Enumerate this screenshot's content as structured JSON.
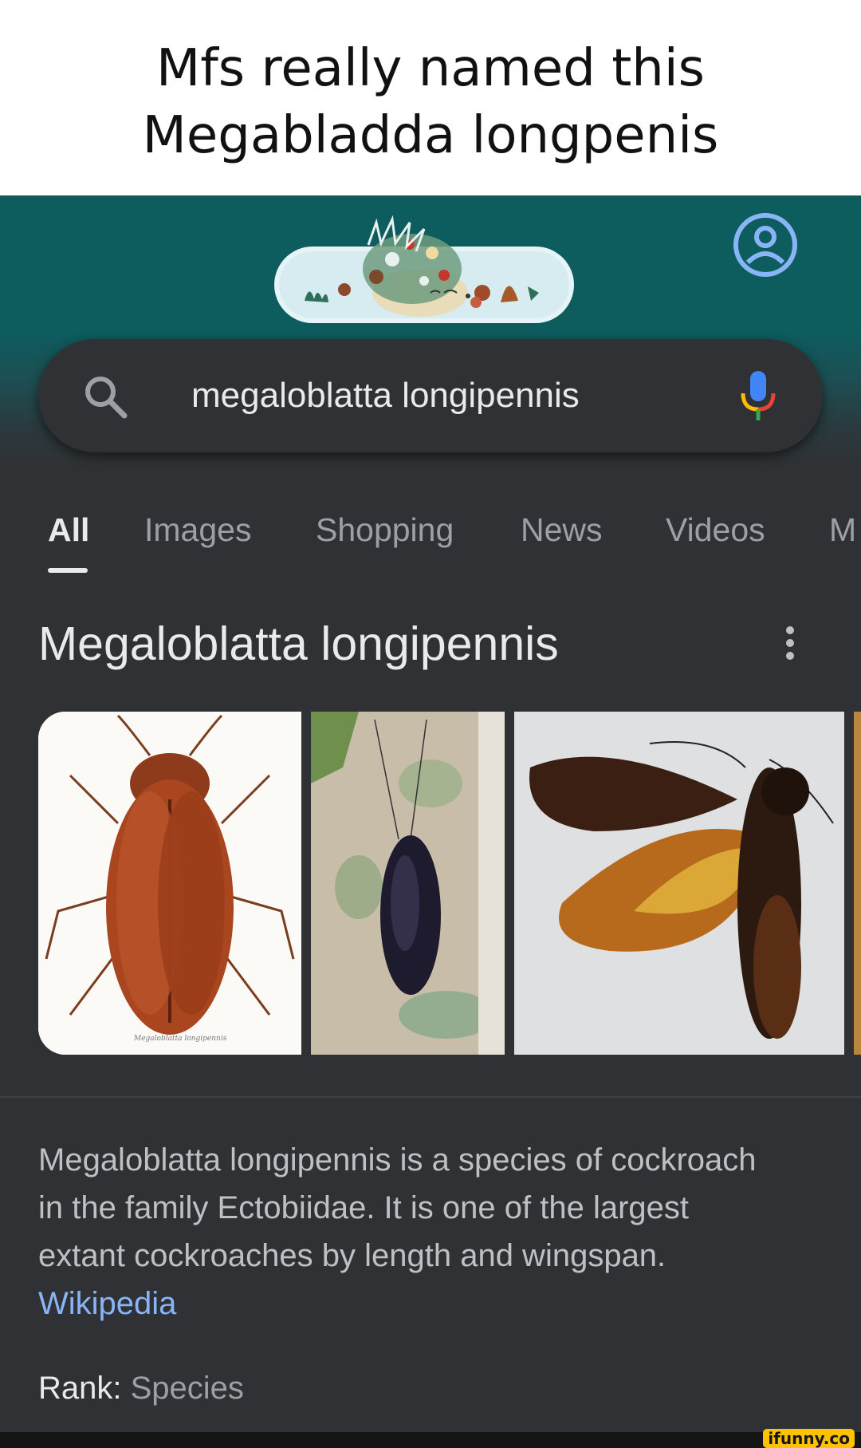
{
  "meme_caption": {
    "line1": "Mfs really named this",
    "line2": "Megabladda longpenis"
  },
  "search": {
    "query": "megaloblatta longipennis"
  },
  "tabs": [
    {
      "label": "All",
      "active": true
    },
    {
      "label": "Images",
      "active": false
    },
    {
      "label": "Shopping",
      "active": false
    },
    {
      "label": "News",
      "active": false
    },
    {
      "label": "Videos",
      "active": false
    },
    {
      "label": "M",
      "active": false
    }
  ],
  "knowledge_panel": {
    "title": "Megaloblatta longipennis",
    "images": [
      {
        "name": "Megaloblatta longipennis illustration"
      },
      {
        "name": "Cockroach on tree trunk photo"
      },
      {
        "name": "Cockroach with spread wings photo"
      }
    ],
    "description_lines": [
      "Megaloblatta longipennis is a species of cockroach",
      "in the family Ectobiidae. It is one of the largest",
      "extant cockroaches by length and wingspan."
    ],
    "source_link": "Wikipedia",
    "rank_label": "Rank:",
    "rank_value": "Species"
  },
  "watermark": "ifunny.co",
  "colors": {
    "header_teal": "#0d5c5e",
    "panel_bg": "#303134",
    "link_blue": "#8ab4f8",
    "watermark_yellow": "#ffc100"
  },
  "icons": [
    "search-icon",
    "mic-icon",
    "account-icon",
    "more-vert-icon"
  ]
}
